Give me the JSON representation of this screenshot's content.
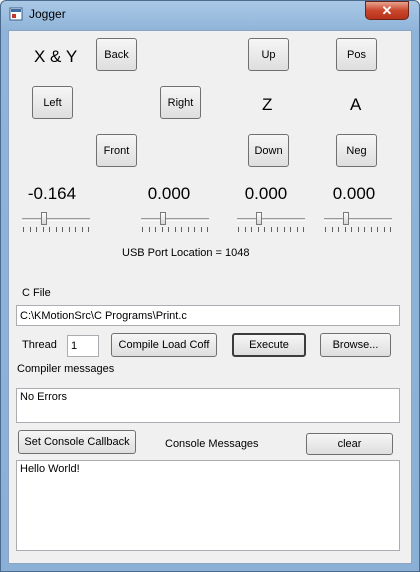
{
  "window": {
    "title": "Jogger",
    "close_glyph": "✕",
    "icon": "app-icon"
  },
  "axes_label_xy": "X & Y",
  "axes_label_z": "Z",
  "axes_label_a": "A",
  "buttons": {
    "back": "Back",
    "up": "Up",
    "pos": "Pos",
    "left": "Left",
    "right": "Right",
    "front": "Front",
    "down": "Down",
    "neg": "Neg",
    "compile": "Compile Load Coff",
    "execute": "Execute",
    "browse": "Browse...",
    "set_console": "Set Console Callback",
    "clear": "clear"
  },
  "positions": [
    "-0.164",
    "0.000",
    "0.000",
    "0.000"
  ],
  "sliders": [
    0.3,
    0.3,
    0.3,
    0.3
  ],
  "usb_port": "USB Port Location = 1048",
  "c_file_label": "C File",
  "c_file_path": "C:\\KMotionSrc\\C Programs\\Print.c",
  "thread_label": "Thread",
  "thread_value": "1",
  "compiler_label": "Compiler messages",
  "compiler_messages": "No Errors",
  "console_label": "Console Messages",
  "console_text": "Hello World!"
}
